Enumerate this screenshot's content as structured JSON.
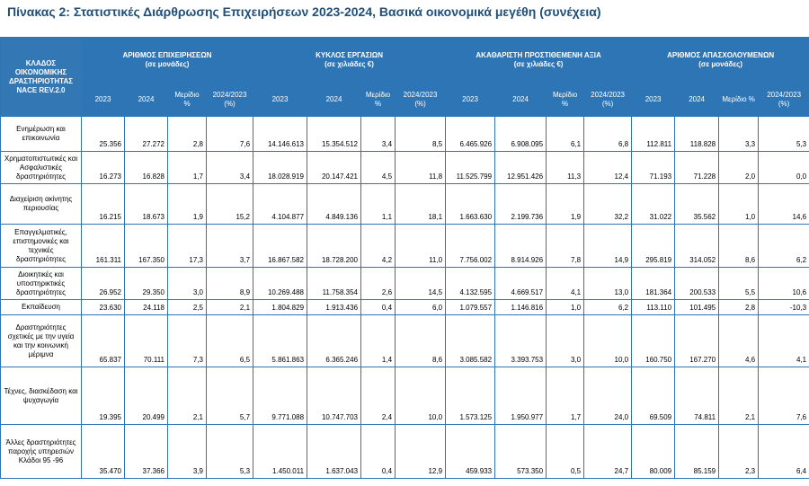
{
  "title": "Πίνακας 2: Στατιστικές Διάρθρωσης Επιχειρήσεων 2023-2024, Βασικά οικονομικά μεγέθη (συνέχεια)",
  "header": {
    "category": "ΚΛΑΔΟΣ ΟΙΚΟΝΟΜΙΚΗΣ ΔΡΑΣΤΗΡΙΟΤΗΤΑΣ NACE REV.2.0",
    "groups": [
      {
        "name": "ΑΡΙΘΜΟΣ ΕΠΙΧΕΙΡΗΣΕΩΝ",
        "unit": "(σε μονάδες)"
      },
      {
        "name": "ΚΥΚΛΟΣ ΕΡΓΑΣΙΩΝ",
        "unit": "(σε χιλιάδες €)"
      },
      {
        "name": "ΑΚΑΘΑΡΙΣΤΗ ΠΡΟΣΤΙΘΕΜΕΝΗ ΑΞΙΑ",
        "unit": "(σε χιλιάδες €)"
      },
      {
        "name": "ΑΡΙΘΜΟΣ ΑΠΑΣΧΟΛΟΥΜΕΝΩΝ",
        "unit": "(σε μονάδες)"
      }
    ],
    "subcols": [
      "2023",
      "2024",
      "Μερίδιο %",
      "2024/2023 (%)"
    ]
  },
  "rows": [
    {
      "category": "Ενημέρωση και επικοινωνία",
      "values": [
        "25.356",
        "27.272",
        "2,8",
        "7,6",
        "14.146.613",
        "15.354.512",
        "3,4",
        "8,5",
        "6.465.926",
        "6.908.095",
        "6,1",
        "6,8",
        "112.811",
        "118.828",
        "3,3",
        "5,3"
      ]
    },
    {
      "category": "Χρηματοπιστωτικές και Ασφαλιστικές δραστηριότητες",
      "values": [
        "16.273",
        "16.828",
        "1,7",
        "3,4",
        "18.028.919",
        "20.147.421",
        "4,5",
        "11,8",
        "11.525.799",
        "12.951.426",
        "11,3",
        "12,4",
        "71.193",
        "71.228",
        "2,0",
        "0,0"
      ]
    },
    {
      "category": "Διαχείριση ακίνητης περιουσίας",
      "values": [
        "16.215",
        "18.673",
        "1,9",
        "15,2",
        "4.104.877",
        "4.849.136",
        "1,1",
        "18,1",
        "1.663.630",
        "2.199.736",
        "1,9",
        "32,2",
        "31.022",
        "35.562",
        "1,0",
        "14,6"
      ]
    },
    {
      "category": "Επαγγελματικές, επιστημονικές και τεχνικές δραστηριότητες",
      "values": [
        "161.311",
        "167.350",
        "17,3",
        "3,7",
        "16.867.582",
        "18.728.200",
        "4,2",
        "11,0",
        "7.756.002",
        "8.914.926",
        "7,8",
        "14,9",
        "295.819",
        "314.052",
        "8,6",
        "6,2"
      ]
    },
    {
      "category": "Διοικητικές και υποστηρικτικές δραστηριότητες",
      "values": [
        "26.952",
        "29.350",
        "3,0",
        "8,9",
        "10.269.488",
        "11.758.354",
        "2,6",
        "14,5",
        "4.132.595",
        "4.669.517",
        "4,1",
        "13,0",
        "181.364",
        "200.533",
        "5,5",
        "10,6"
      ]
    },
    {
      "category": "Εκπαίδευση",
      "values": [
        "23.630",
        "24.118",
        "2,5",
        "2,1",
        "1.804.829",
        "1.913.436",
        "0,4",
        "6,0",
        "1.079.557",
        "1.146.816",
        "1,0",
        "6,2",
        "113.110",
        "101.495",
        "2,8",
        "-10,3"
      ]
    },
    {
      "category": "Δραστηριότητες σχετικές με την υγεία και την κοινωνική μέριμνα",
      "values": [
        "65.837",
        "70.111",
        "7,3",
        "6,5",
        "5.861.863",
        "6.365.246",
        "1,4",
        "8,6",
        "3.085.582",
        "3.393.753",
        "3,0",
        "10,0",
        "160.750",
        "167.270",
        "4,6",
        "4,1"
      ]
    },
    {
      "category": "Τέχνες, διασκέδαση και ψυχαγωγία",
      "values": [
        "19.395",
        "20.499",
        "2,1",
        "5,7",
        "9.771.088",
        "10.747.703",
        "2,4",
        "10,0",
        "1.573.125",
        "1.950.977",
        "1,7",
        "24,0",
        "69.509",
        "74.811",
        "2,1",
        "7,6"
      ]
    },
    {
      "category": "Άλλες δραστηριότητες παροχής υπηρεσιών Κλάδοι 95 -96",
      "values": [
        "35.470",
        "37.366",
        "3,9",
        "5,3",
        "1.450.011",
        "1.637.043",
        "0,4",
        "12,9",
        "459.933",
        "573.350",
        "0,5",
        "24,7",
        "80.009",
        "85.159",
        "2,3",
        "6,4"
      ]
    }
  ]
}
